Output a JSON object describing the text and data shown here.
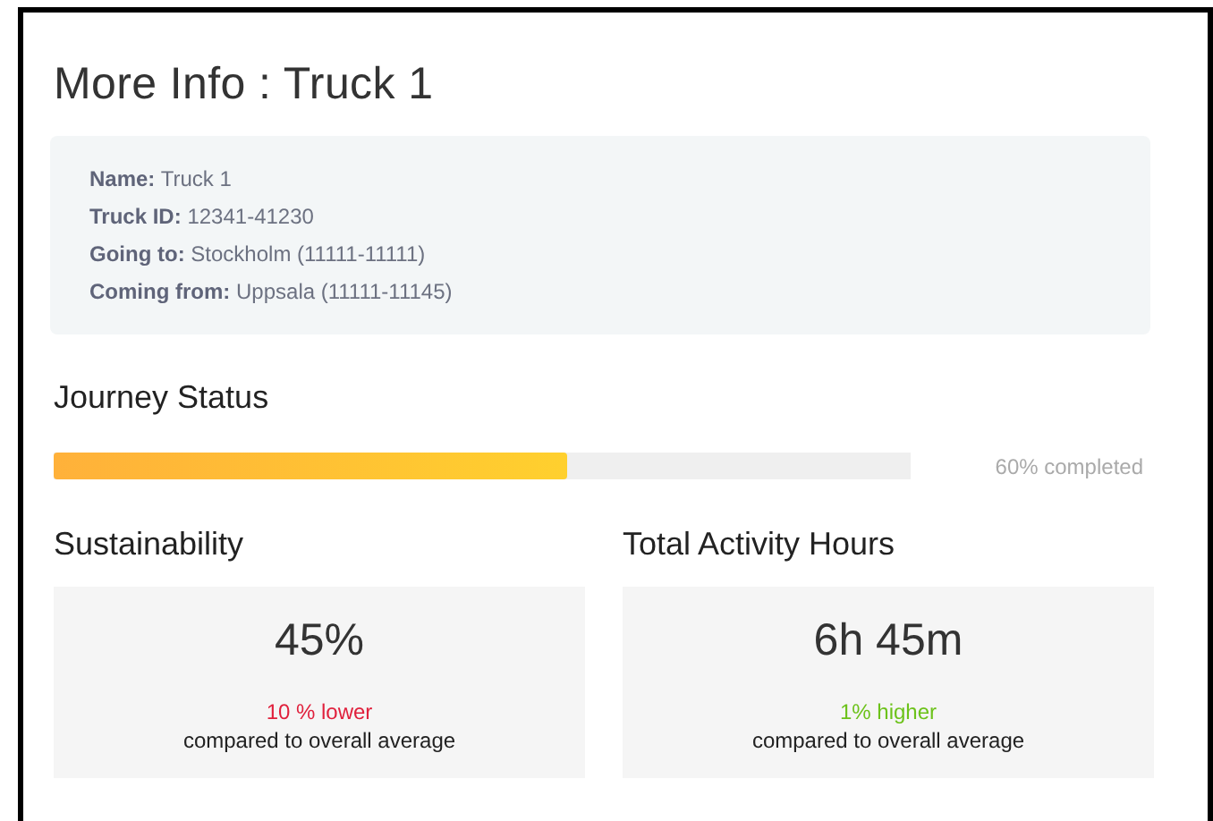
{
  "title": "More Info : Truck 1",
  "details": [
    {
      "label": "Name:",
      "value": "Truck 1"
    },
    {
      "label": "Truck ID:",
      "value": "12341-41230"
    },
    {
      "label": "Going to:",
      "value": "Stockholm (11111-11111)"
    },
    {
      "label": "Coming from:",
      "value": "Uppsala (11111-11145)"
    }
  ],
  "journey": {
    "heading": "Journey Status",
    "level": 0.6,
    "reading": "60% completed"
  },
  "stats": [
    {
      "heading": "Sustainability",
      "value": "45%",
      "change": "10 % lower",
      "kind": "lower",
      "note": "compared to overall average"
    },
    {
      "heading": "Total Activity Hours",
      "value": "6h 45m",
      "change": "1% higher",
      "kind": "higher",
      "note": "compared to overall average"
    }
  ]
}
